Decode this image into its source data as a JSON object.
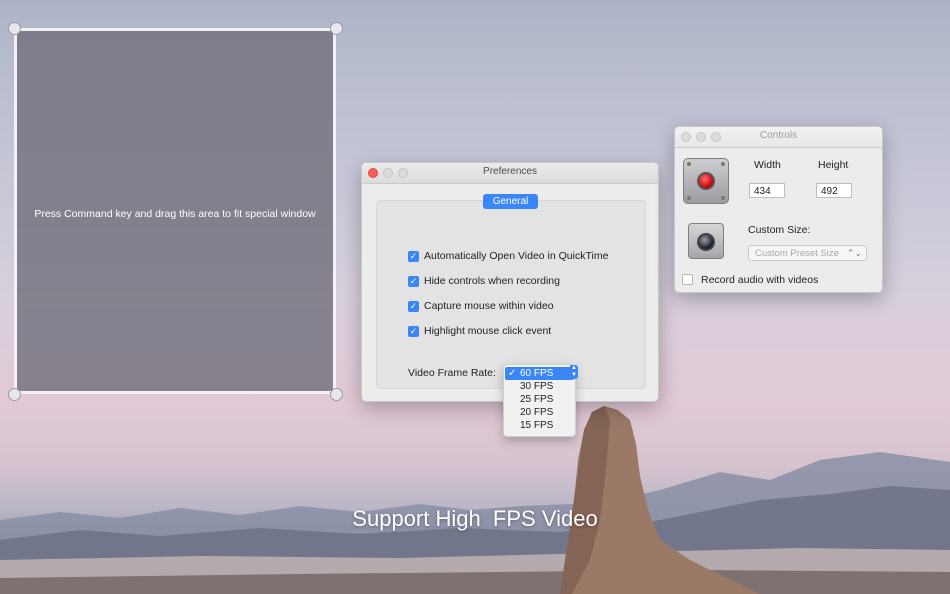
{
  "capture_area": {
    "hint": "Press Command key and drag this area to fit special window"
  },
  "preferences": {
    "title": "Preferences",
    "tab": "General",
    "options": [
      {
        "label": "Automatically Open Video in QuickTime",
        "checked": true
      },
      {
        "label": "Hide controls when recording",
        "checked": true
      },
      {
        "label": "Capture mouse within video",
        "checked": true
      },
      {
        "label": "Highlight mouse click event",
        "checked": true
      }
    ],
    "frame_rate_label": "Video Frame Rate:",
    "frame_rate_options": [
      "60 FPS",
      "30 FPS",
      "25 FPS",
      "20 FPS",
      "15 FPS"
    ],
    "frame_rate_selected": "60 FPS"
  },
  "controls": {
    "title": "Controls",
    "width_label": "Width",
    "height_label": "Height",
    "width_value": "434",
    "height_value": "492",
    "custom_size_label": "Custom Size:",
    "preset_placeholder": "Custom Preset Size",
    "record_audio_label": "Record audio with videos",
    "record_audio_checked": false
  },
  "tagline": "Support High  FPS Video",
  "colors": {
    "accent": "#3b86f7",
    "close": "#fc5f57",
    "minimize": "#fdbc2e",
    "zoom": "#28c840",
    "inactive_light": "#dcdcdc"
  }
}
